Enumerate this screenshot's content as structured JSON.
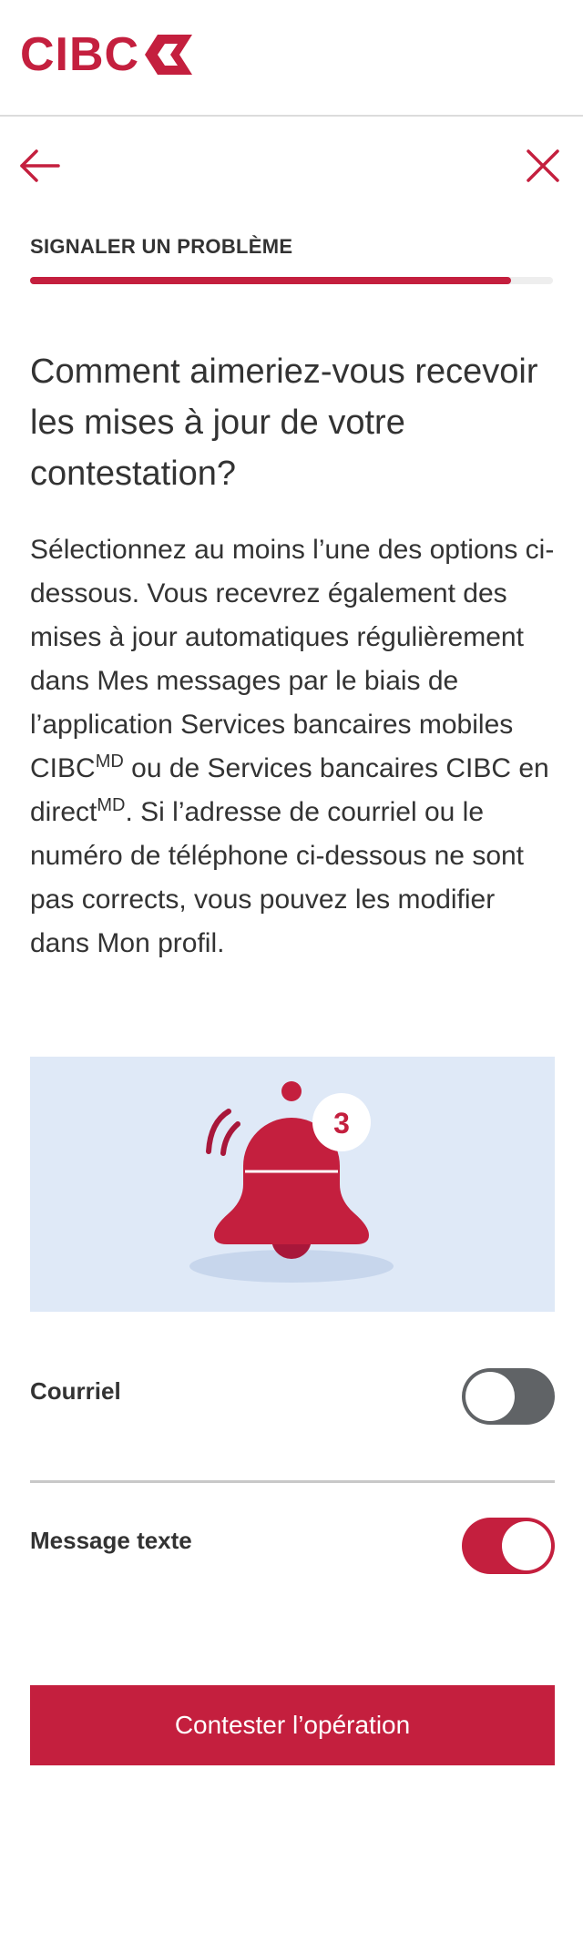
{
  "brand": {
    "logo_text": "CIBC",
    "accent_color": "#c41f3e"
  },
  "nav": {
    "back_icon": "arrow-left-icon",
    "close_icon": "close-icon"
  },
  "step": {
    "label": "SIGNALER UN PROBLÈME",
    "progress_fraction": 0.92
  },
  "question": "Comment aimeriez-vous recevoir les mises à jour de votre contestation?",
  "description": {
    "part1": "Sélectionnez au moins l’une des options ci-dessous. Vous recevrez également des mises à jour automatiques régulièrement dans Mes messages par le biais de l’application Services bancaires mobiles CIBC",
    "sup1": "MD",
    "part2": " ou de Services bancaires CIBC en direct",
    "sup2": "MD",
    "part3": ". Si l’adresse de courriel ou le numéro de téléphone ci-dessous ne sont pas corrects, vous pouvez les modifier dans Mon profil."
  },
  "illustration": {
    "icon": "notification-bell-icon",
    "badge_count": "3",
    "background_color": "#dfe9f7"
  },
  "options": [
    {
      "label": "Courriel",
      "checked": false
    },
    {
      "label": "Message texte",
      "checked": true
    }
  ],
  "cta": {
    "label": "Contester l’opération"
  }
}
